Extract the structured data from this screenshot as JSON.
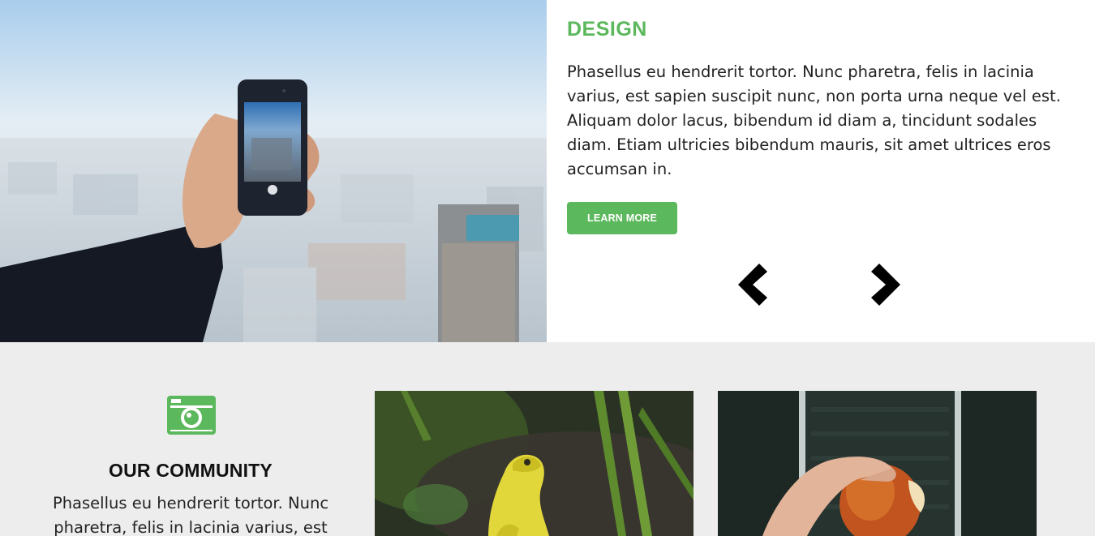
{
  "hero": {
    "image_alt": "Hand holding a smartphone photographing a city skyline",
    "title": "DESIGN",
    "text": "Phasellus eu hendrerit tortor. Nunc pharetra, felis in lacinia varius, est sapien suscipit nunc, non porta urna neque vel est. Aliquam dolor lacus, bibendum id diam a, tincidunt sodales diam. Etiam ultricies bibendum mauris, sit amet ultrices eros accumsan in.",
    "button_label": "LEARN MORE",
    "prev_icon": "chevron-left-icon",
    "next_icon": "chevron-right-icon"
  },
  "community": {
    "icon": "camera-icon",
    "title": "OUR COMMUNITY",
    "text": "Phasellus eu hendrerit tortor. Nunc pharetra, felis in lacinia varius, est"
  },
  "gallery": [
    {
      "icon": "frog-photo",
      "alt": "Yellow frog among green leaves"
    },
    {
      "icon": "apple-photo",
      "alt": "Hand holding a bitten apple on an escalator"
    }
  ],
  "colors": {
    "accent": "#5cb85c",
    "section_bg": "#ededed",
    "text": "#222222",
    "arrows": "#000000"
  }
}
